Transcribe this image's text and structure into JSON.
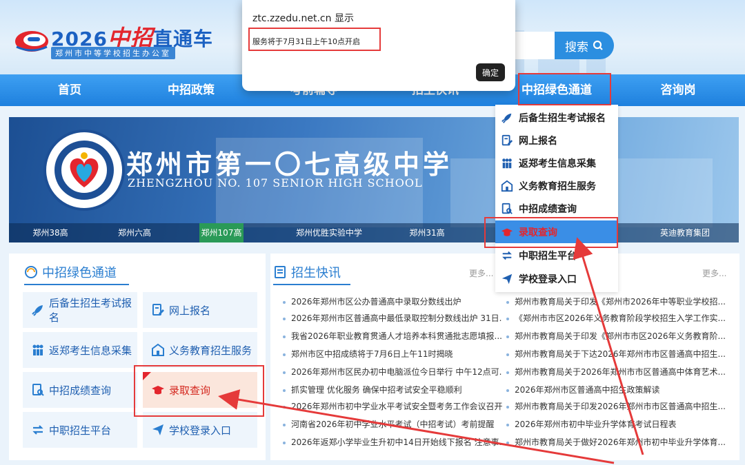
{
  "header": {
    "logo_year": "2026",
    "logo_highlight": "中招",
    "logo_rest": "直通车",
    "logo_sub": "郑州市中等学校招生办公室",
    "search_label": "搜索"
  },
  "nav": {
    "items": [
      {
        "label": "首页"
      },
      {
        "label": "中招政策"
      },
      {
        "label": "考前辅导"
      },
      {
        "label": "招生快讯"
      },
      {
        "label": "中招绿色通道"
      },
      {
        "label": "咨询岗"
      }
    ]
  },
  "banner": {
    "title_cn": "郑州市第一〇七高级中学",
    "title_en": "ZHENGZHOU NO. 107 SENIOR HIGH SCHOOL",
    "schools": [
      "郑州38高",
      "郑州六高",
      "郑州107高",
      "郑州优胜实验中学",
      "郑州31高",
      "英迪教育集团"
    ],
    "active_school": "郑州107高"
  },
  "left_panel": {
    "title": "中招绿色通道",
    "buttons": [
      {
        "label": "后备生招生考试报名",
        "icon": "rocket-icon"
      },
      {
        "label": "网上报名",
        "icon": "edit-doc-icon"
      },
      {
        "label": "返郑考生信息采集",
        "icon": "people-icon"
      },
      {
        "label": "义务教育招生服务",
        "icon": "school-icon"
      },
      {
        "label": "中招成绩查询",
        "icon": "doc-search-icon"
      },
      {
        "label": "录取查询",
        "icon": "graduation-cap-icon"
      },
      {
        "label": "中职招生平台",
        "icon": "exchange-icon"
      },
      {
        "label": "学校登录入口",
        "icon": "paper-plane-icon"
      }
    ]
  },
  "news_panel": {
    "title": "招生快讯",
    "more_label": "更多...",
    "left_col": [
      "2026年郑州市区公办普通高中录取分数线出炉",
      "2026年郑州市区普通高中最低录取控制分数线出炉 31日...",
      "我省2026年职业教育贯通人才培养本科贯通批志愿填报...",
      "郑州市区中招成绩将于7月6日上午11时揭晓",
      "2026年郑州市区民办初中电脑派位今日举行 中午12点可...",
      "抓实管理 优化服务 确保中招考试安全平稳顺利",
      "2026年郑州市初中学业水平考试安全暨考务工作会议召开",
      "河南省2026年初中学业水平考试（中招考试）考前提醒",
      "2026年返郑小学毕业生升初中14日开始线下报名 注意事..."
    ],
    "right_col": [
      "郑州市教育局关于印发《郑州市2026年中等职业学校招...",
      "《郑州市市区2026年义务教育阶段学校招生入学工作实...",
      "郑州市教育局关于印发《郑州市市区2026年义务教育阶...",
      "郑州市教育局关于下达2026年郑州市市区普通高中招生...",
      "郑州市教育局关于2026年郑州市市区普通高中体育艺术...",
      "2026年郑州市区普通高中招生政策解读",
      "郑州市教育局关于印发2026年郑州市市区普通高中招生...",
      "2026年郑州市初中毕业升学体育考试日程表",
      "郑州市教育局关于做好2026年郑州市初中毕业升学体育..."
    ]
  },
  "dropdown": {
    "items": [
      {
        "label": "后备生招生考试报名",
        "icon": "rocket-icon"
      },
      {
        "label": "网上报名",
        "icon": "edit-doc-icon"
      },
      {
        "label": "返郑考生信息采集",
        "icon": "people-icon"
      },
      {
        "label": "义务教育招生服务",
        "icon": "school-icon"
      },
      {
        "label": "中招成绩查询",
        "icon": "doc-search-icon"
      },
      {
        "label": "录取查询",
        "icon": "graduation-cap-icon"
      },
      {
        "label": "中职招生平台",
        "icon": "exchange-icon"
      },
      {
        "label": "学校登录入口",
        "icon": "paper-plane-icon"
      }
    ],
    "selected": "录取查询"
  },
  "dialog": {
    "title": "ztc.zzedu.net.cn 显示",
    "message": "服务将于7月31日上午10点开启",
    "ok_label": "确定"
  },
  "colors": {
    "brand_blue": "#2a7ed0",
    "nav_blue": "#1e80de",
    "annotation_red": "#e53a3a",
    "highlight_bg": "#fbe6dc"
  }
}
